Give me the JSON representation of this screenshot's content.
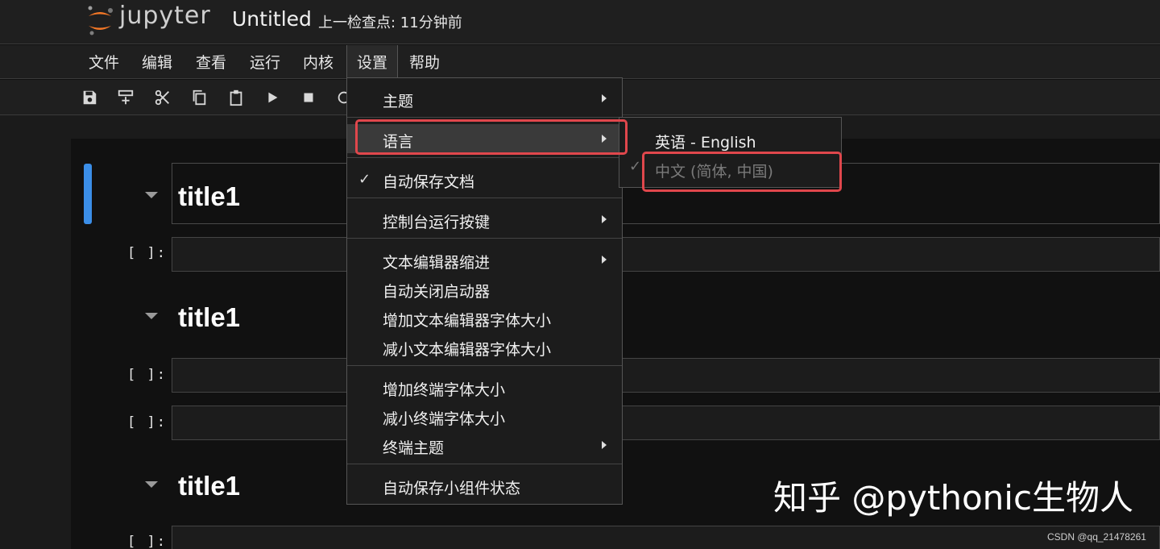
{
  "header": {
    "logo_text": "jupyter",
    "notebook_title": "Untitled",
    "checkpoint": "上一检查点: 11分钟前"
  },
  "menubar": [
    "文件",
    "编辑",
    "查看",
    "运行",
    "内核",
    "设置",
    "帮助"
  ],
  "active_menu": "设置",
  "toolbar": [
    {
      "icon": "save-icon"
    },
    {
      "icon": "insert-cell-icon"
    },
    {
      "icon": "cut-icon"
    },
    {
      "icon": "copy-icon"
    },
    {
      "icon": "paste-icon"
    },
    {
      "icon": "run-icon"
    },
    {
      "icon": "stop-icon"
    },
    {
      "icon": "restart-icon"
    }
  ],
  "cells": {
    "headings": [
      "title1",
      "title1",
      "title1"
    ],
    "prompt": "[ ]:"
  },
  "settings_menu": {
    "items": [
      {
        "label": "主题",
        "submenu": true
      },
      {
        "label": "语言",
        "submenu": true,
        "highlighted": true
      },
      {
        "label": "自动保存文档",
        "checked": true
      },
      {
        "label": "控制台运行按键",
        "submenu": true
      },
      {
        "label": "文本编辑器缩进",
        "submenu": true
      },
      {
        "label": "自动关闭启动器"
      },
      {
        "label": "增加文本编辑器字体大小"
      },
      {
        "label": "减小文本编辑器字体大小"
      },
      {
        "label": "增加终端字体大小"
      },
      {
        "label": "减小终端字体大小"
      },
      {
        "label": "终端主题",
        "submenu": true
      },
      {
        "label": "自动保存小组件状态"
      }
    ]
  },
  "language_submenu": {
    "items": [
      {
        "label": "英语 - English",
        "enabled": true
      },
      {
        "label": "中文 (简体, 中国)",
        "enabled": false,
        "checked": true
      }
    ]
  },
  "watermark": "知乎 @pythonic生物人",
  "credit": "CSDN @qq_21478261",
  "colors": {
    "accent": "#3b8ee8",
    "highlight_frame": "#e0474c",
    "logo_orange": "#f37726"
  }
}
